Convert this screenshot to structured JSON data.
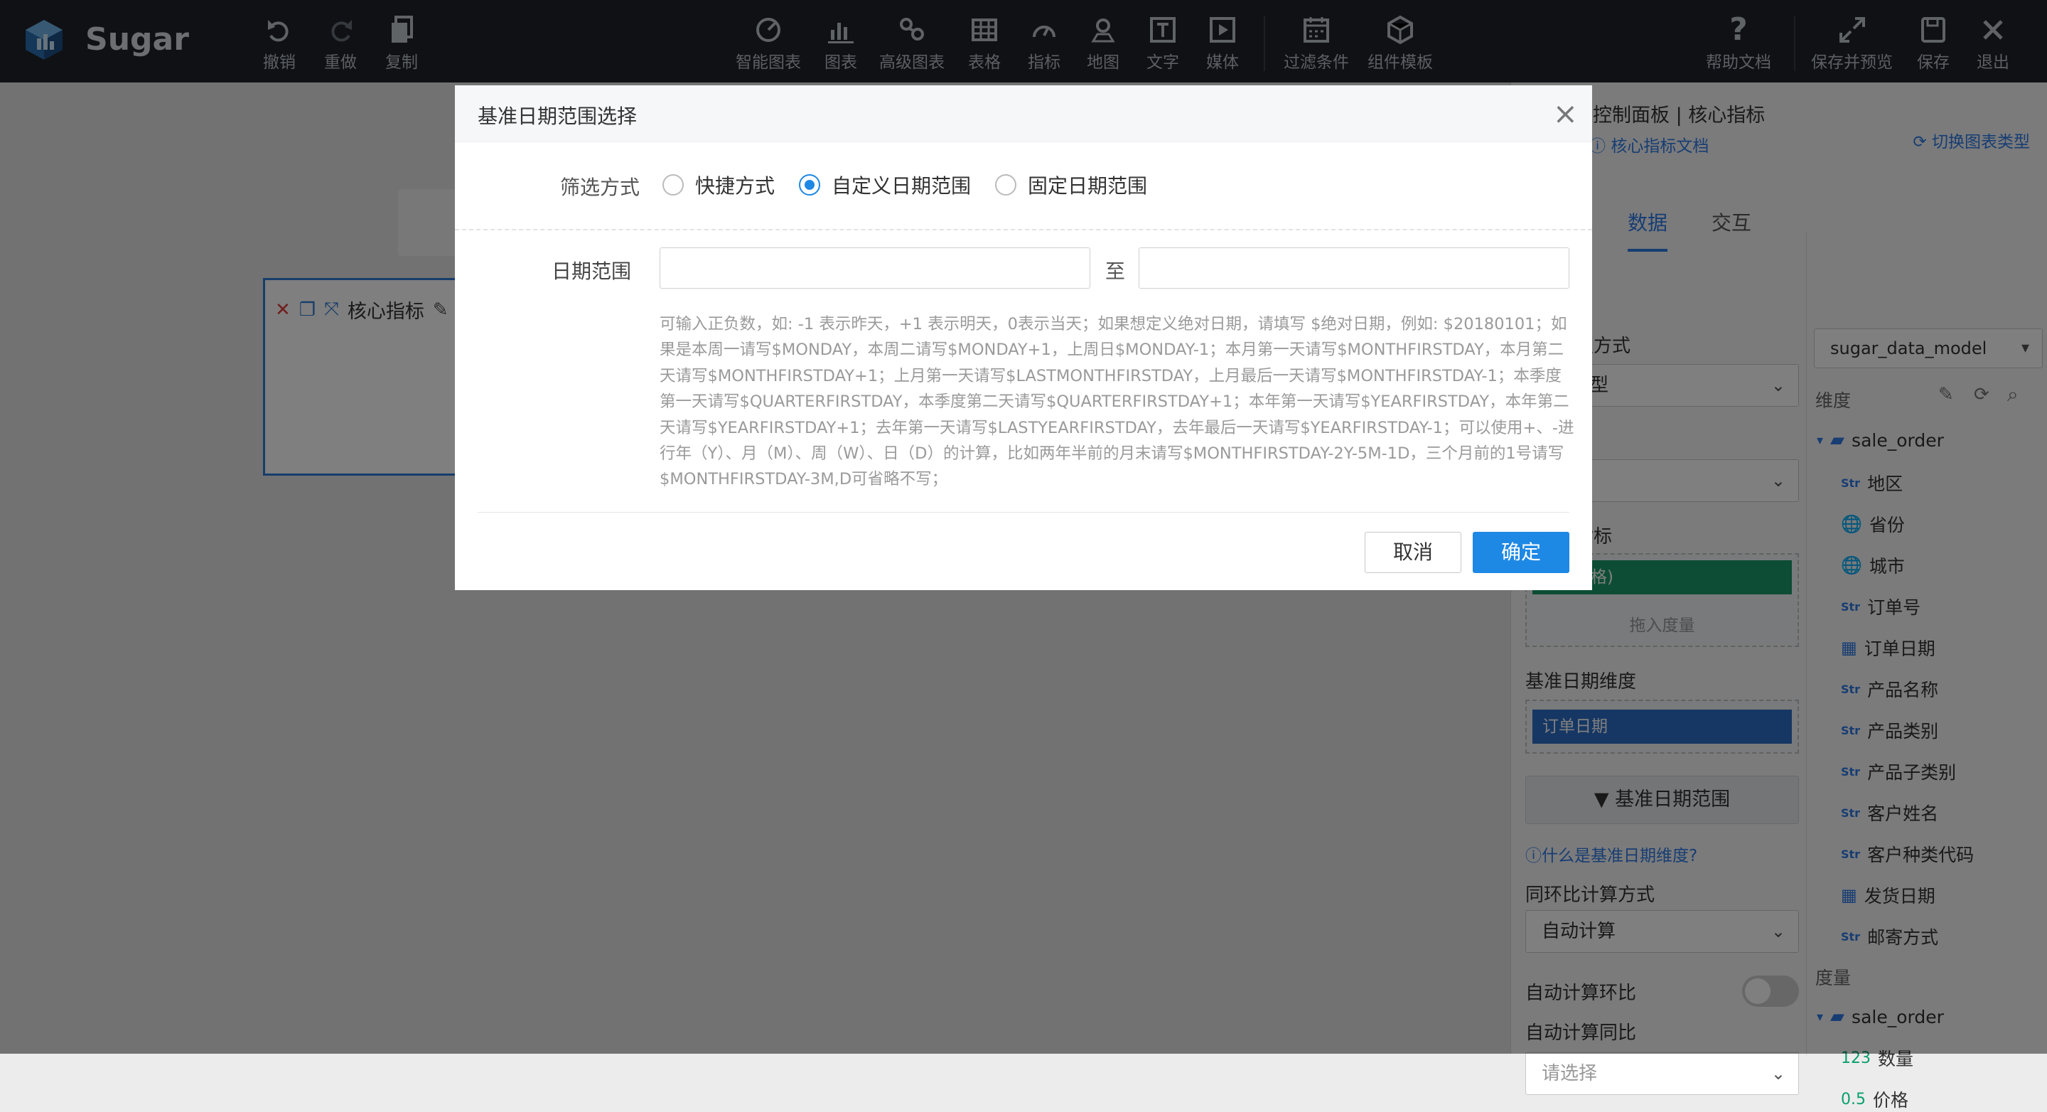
{
  "app": {
    "brand": "Sugar"
  },
  "toolbar": {
    "left": [
      {
        "label": "撤销",
        "icon": "undo-icon"
      },
      {
        "label": "重做",
        "icon": "redo-icon"
      },
      {
        "label": "复制",
        "icon": "copy-icon"
      }
    ],
    "center": [
      {
        "label": "智能图表",
        "icon": "smart-chart-icon"
      },
      {
        "label": "图表",
        "icon": "bar-chart-icon"
      },
      {
        "label": "高级图表",
        "icon": "advanced-chart-icon"
      },
      {
        "label": "表格",
        "icon": "table-icon"
      },
      {
        "label": "指标",
        "icon": "gauge-icon"
      },
      {
        "label": "地图",
        "icon": "map-pin-icon"
      },
      {
        "label": "文字",
        "icon": "text-icon"
      },
      {
        "label": "媒体",
        "icon": "media-icon"
      },
      {
        "label": "过滤条件",
        "icon": "filter-calendar-icon"
      },
      {
        "label": "组件模板",
        "icon": "template-cube-icon"
      }
    ],
    "right": [
      {
        "label": "帮助文档",
        "icon": "help-icon"
      },
      {
        "label": "保存并预览",
        "icon": "expand-icon"
      },
      {
        "label": "保存",
        "icon": "save-icon"
      },
      {
        "label": "退出",
        "icon": "close-icon"
      }
    ]
  },
  "canvas": {
    "widget_title": "核心指标"
  },
  "panel": {
    "title": "控制面板 | 核心指标",
    "doc_link": "核心指标文档",
    "switch_link": "切换图表类型",
    "tabs": {
      "data": "数据",
      "interact": "交互"
    },
    "labels": {
      "method": "定方式",
      "method_value": "型",
      "metric": "指标",
      "drop_hint": "拖入度量",
      "base_dim": "基准日期维度",
      "base_dim_value": "订单日期",
      "range_btn": "基准日期范围",
      "what_is": "什么是基准日期维度?",
      "calc_method": "同环比计算方式",
      "calc_value": "自动计算",
      "auto_ring": "自动计算环比",
      "auto_yoy": "自动计算同比",
      "auto_yoy_placeholder": "请选择",
      "pill_green": "格)"
    },
    "model": "sugar_data_model",
    "dim_header": "维度",
    "measure_header": "度量",
    "dim_folder": "sale_order",
    "dims": [
      {
        "type": "Str",
        "label": "地区"
      },
      {
        "type": "geo",
        "label": "省份"
      },
      {
        "type": "geo",
        "label": "城市"
      },
      {
        "type": "Str",
        "label": "订单号"
      },
      {
        "type": "date",
        "label": "订单日期"
      },
      {
        "type": "Str",
        "label": "产品名称"
      },
      {
        "type": "Str",
        "label": "产品类别"
      },
      {
        "type": "Str",
        "label": "产品子类别"
      },
      {
        "type": "Str",
        "label": "客户姓名"
      },
      {
        "type": "Str",
        "label": "客户种类代码"
      },
      {
        "type": "date",
        "label": "发货日期"
      },
      {
        "type": "Str",
        "label": "邮寄方式"
      }
    ],
    "measure_folder": "sale_order",
    "measures": [
      {
        "type": "123",
        "label": "数量"
      },
      {
        "type": "0.5",
        "label": "价格"
      }
    ]
  },
  "modal": {
    "title": "基准日期范围选择",
    "filter_label": "筛选方式",
    "options": [
      "快捷方式",
      "自定义日期范围",
      "固定日期范围"
    ],
    "selected": "自定义日期范围",
    "range_label": "日期范围",
    "to": "至",
    "start_value": "",
    "end_value": "",
    "help": "可输入正负数，如: -1 表示昨天，+1 表示明天，0表示当天；如果想定义绝对日期，请填写 $绝对日期，例如: $20180101；如果是本周一请写$MONDAY，本周二请写$MONDAY+1，上周日$MONDAY-1；本月第一天请写$MONTHFIRSTDAY，本月第二天请写$MONTHFIRSTDAY+1；上月第一天请写$LASTMONTHFIRSTDAY，上月最后一天请写$MONTHFIRSTDAY-1；本季度第一天请写$QUARTERFIRSTDAY，本季度第二天请写$QUARTERFIRSTDAY+1；本年第一天请写$YEARFIRSTDAY，本年第二天请写$YEARFIRSTDAY+1；去年第一天请写$LASTYEARFIRSTDAY，去年最后一天请写$YEARFIRSTDAY-1；可以使用+、-进行年（Y）、月（M）、周（W）、日（D）的计算，比如两年半前的月末请写$MONTHFIRSTDAY-2Y-5M-1D，三个月前的1号请写$MONTHFIRSTDAY-3M,D可省略不写；",
    "cancel": "取消",
    "ok": "确定"
  },
  "colors": {
    "accent": "#1e88e5",
    "topbar": "#1f2328",
    "green_pill": "#1a9b6a",
    "blue_pill": "#2d6fc8"
  }
}
